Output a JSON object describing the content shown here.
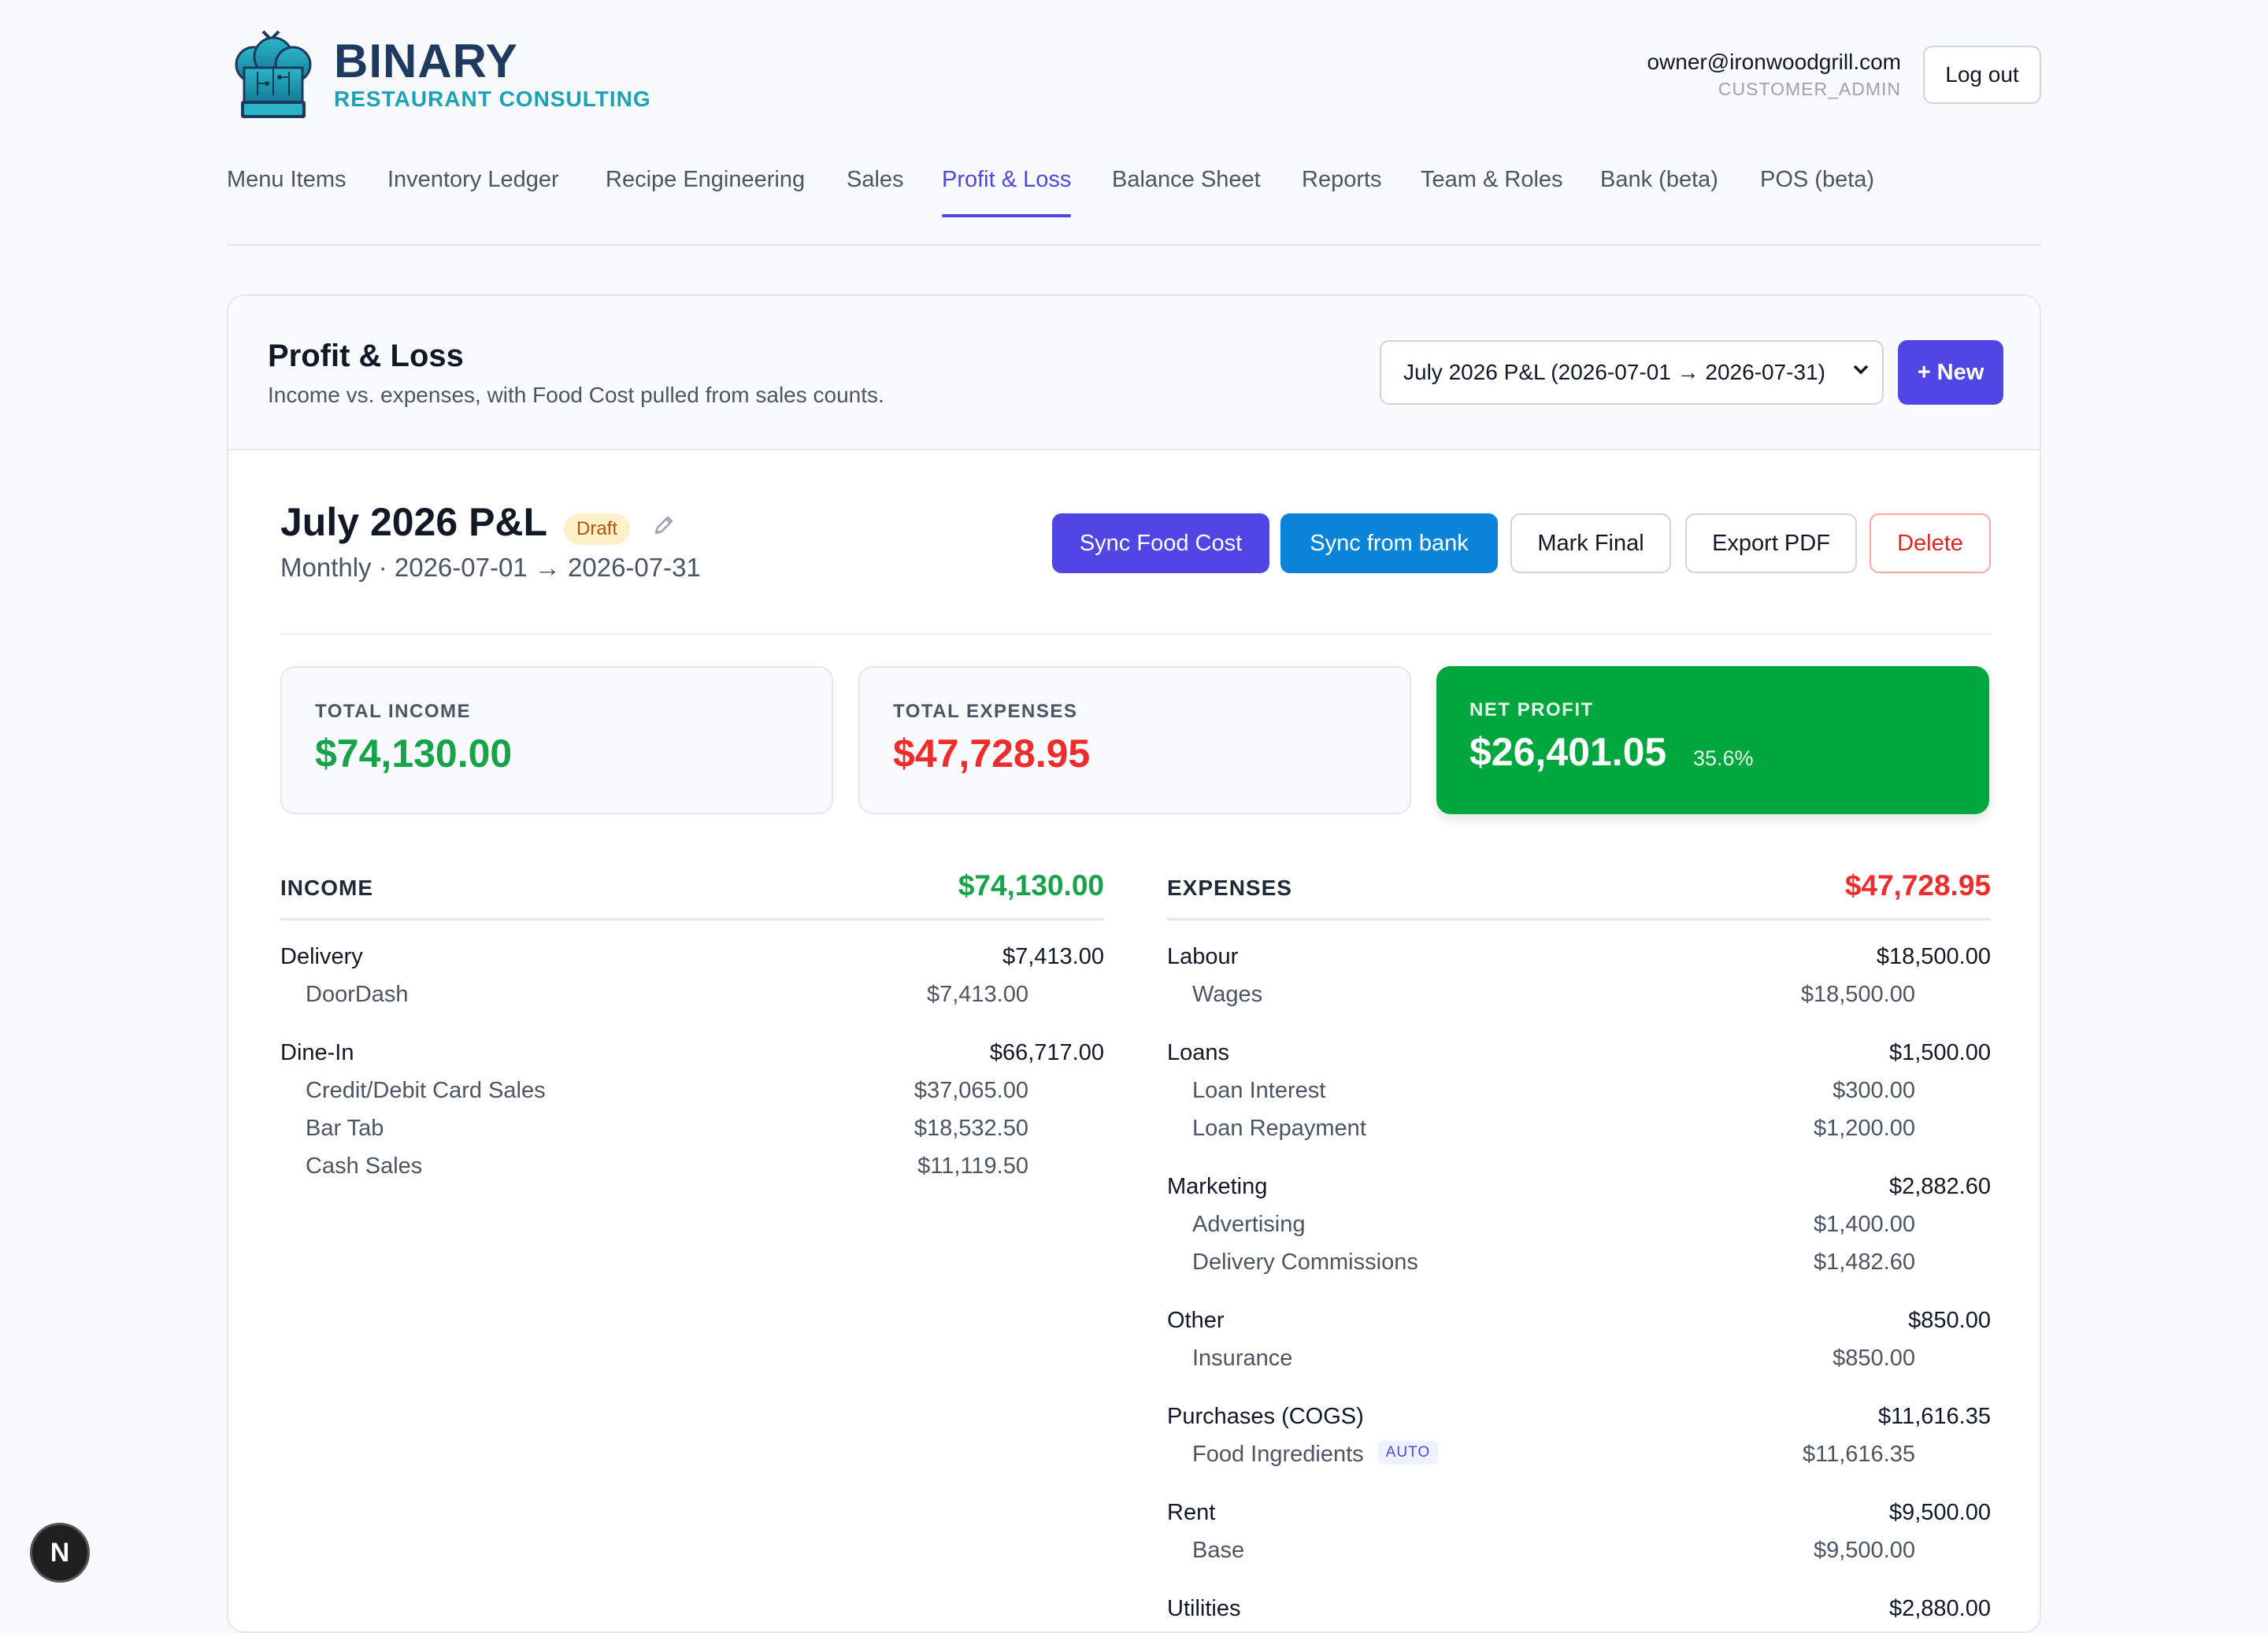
{
  "brand": {
    "name": "BINARY",
    "subtitle": "RESTAURANT CONSULTING"
  },
  "user": {
    "email": "owner@ironwoodgrill.com",
    "role": "CUSTOMER_ADMIN",
    "logout_label": "Log out"
  },
  "nav": [
    {
      "label": "Menu Items",
      "active": false
    },
    {
      "label": "Inventory Ledger",
      "active": false
    },
    {
      "label": "Recipe Engineering",
      "active": false
    },
    {
      "label": "Sales",
      "active": false
    },
    {
      "label": "Profit & Loss",
      "active": true
    },
    {
      "label": "Balance Sheet",
      "active": false
    },
    {
      "label": "Reports",
      "active": false
    },
    {
      "label": "Team & Roles",
      "active": false
    },
    {
      "label": "Bank (beta)",
      "active": false
    },
    {
      "label": "POS (beta)",
      "active": false
    }
  ],
  "page": {
    "title": "Profit & Loss",
    "subtitle": "Income vs. expenses, with Food Cost pulled from sales counts.",
    "period_selected": "July 2026 P&L (2026-07-01 → 2026-07-31)",
    "new_label": "+ New"
  },
  "pl": {
    "name": "July 2026 P&L",
    "status": "Draft",
    "range": "Monthly · 2026-07-01 → 2026-07-31",
    "actions": {
      "sync_food": "Sync Food Cost",
      "sync_bank": "Sync from bank",
      "mark_final": "Mark Final",
      "export": "Export PDF",
      "delete": "Delete"
    }
  },
  "summary": {
    "income_label": "TOTAL INCOME",
    "income_value": "$74,130.00",
    "expenses_label": "TOTAL EXPENSES",
    "expenses_value": "$47,728.95",
    "net_label": "NET PROFIT",
    "net_value": "$26,401.05",
    "net_pct": "35.6%"
  },
  "income": {
    "title": "INCOME",
    "total": "$74,130.00",
    "groups": [
      {
        "name": "Delivery",
        "amount": "$7,413.00",
        "items": [
          {
            "name": "DoorDash",
            "amount": "$7,413.00"
          }
        ]
      },
      {
        "name": "Dine-In",
        "amount": "$66,717.00",
        "items": [
          {
            "name": "Credit/Debit Card Sales",
            "amount": "$37,065.00"
          },
          {
            "name": "Bar Tab",
            "amount": "$18,532.50"
          },
          {
            "name": "Cash Sales",
            "amount": "$11,119.50"
          }
        ]
      }
    ]
  },
  "expenses": {
    "title": "EXPENSES",
    "total": "$47,728.95",
    "auto_badge": "AUTO",
    "groups": [
      {
        "name": "Labour",
        "amount": "$18,500.00",
        "items": [
          {
            "name": "Wages",
            "amount": "$18,500.00"
          }
        ]
      },
      {
        "name": "Loans",
        "amount": "$1,500.00",
        "items": [
          {
            "name": "Loan Interest",
            "amount": "$300.00"
          },
          {
            "name": "Loan Repayment",
            "amount": "$1,200.00"
          }
        ]
      },
      {
        "name": "Marketing",
        "amount": "$2,882.60",
        "items": [
          {
            "name": "Advertising",
            "amount": "$1,400.00"
          },
          {
            "name": "Delivery Commissions",
            "amount": "$1,482.60"
          }
        ]
      },
      {
        "name": "Other",
        "amount": "$850.00",
        "items": [
          {
            "name": "Insurance",
            "amount": "$850.00"
          }
        ]
      },
      {
        "name": "Purchases (COGS)",
        "amount": "$11,616.35",
        "items": [
          {
            "name": "Food Ingredients",
            "amount": "$11,616.35",
            "auto": true
          }
        ]
      },
      {
        "name": "Rent",
        "amount": "$9,500.00",
        "items": [
          {
            "name": "Base",
            "amount": "$9,500.00"
          }
        ]
      },
      {
        "name": "Utilities",
        "amount": "$2,880.00",
        "items": []
      }
    ]
  },
  "dev_badge": "N",
  "colors": {
    "accent": "#4f46e5",
    "income": "#16a34a",
    "expense": "#ef2b2b",
    "net_bg": "#00a63e",
    "bank": "#0a84d9"
  }
}
